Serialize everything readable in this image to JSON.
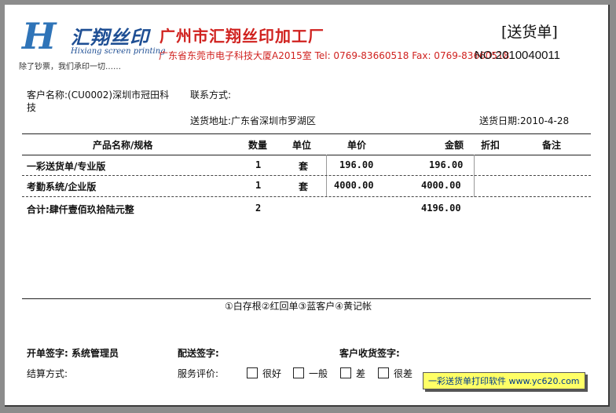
{
  "header": {
    "logo_cn": "汇翔丝印",
    "logo_en": "Hixiang screen printing",
    "logo_slogan": "除了钞票，我们承印一切……",
    "company_name": "广州市汇翔丝印加工厂",
    "address_line": "广东省东莞市电子科技大厦A2015室 Tel: 0769-83660518 Fax: 0769-83660518",
    "doc_title": "[送货单]",
    "doc_no": "NO:2010040011"
  },
  "customer": {
    "name_line1": "客户名称:(CU0002)深圳市冠田科",
    "name_line2": "技",
    "contact_label": "联系方式:",
    "address": "送货地址:广东省深圳市罗湖区",
    "date": "送货日期:2010-4-28"
  },
  "table": {
    "headers": [
      "产品名称/规格",
      "数量",
      "单位",
      "单价",
      "金额",
      "折扣",
      "备注"
    ],
    "rows": [
      {
        "name": "一彩送货单/专业版",
        "qty": "1",
        "unit": "套",
        "price": "196.00",
        "amount": "196.00"
      },
      {
        "name": "考勤系统/企业版",
        "qty": "1",
        "unit": "套",
        "price": "4000.00",
        "amount": "4000.00"
      }
    ],
    "total": {
      "label": "合计:肆仟壹佰玖拾陆元整",
      "qty": "2",
      "amount": "4196.00"
    }
  },
  "footer": {
    "copies": "①白存根②红回单③蓝客户④黄记帐",
    "issuer": "开单签字: 系统管理员",
    "delivery_sign": "配送签字:",
    "customer_sign": "客户收货签字:",
    "settlement": "结算方式:",
    "rating_label": "服务评价:",
    "ratings": [
      "很好",
      "一般",
      "差",
      "很差"
    ]
  },
  "watermark": "一彩送货单打印软件 www.yc620.com",
  "colors": {
    "brand_red": "#d0221f",
    "logo_blue": "#2f74b8",
    "watermark_bg": "#ffff66"
  }
}
